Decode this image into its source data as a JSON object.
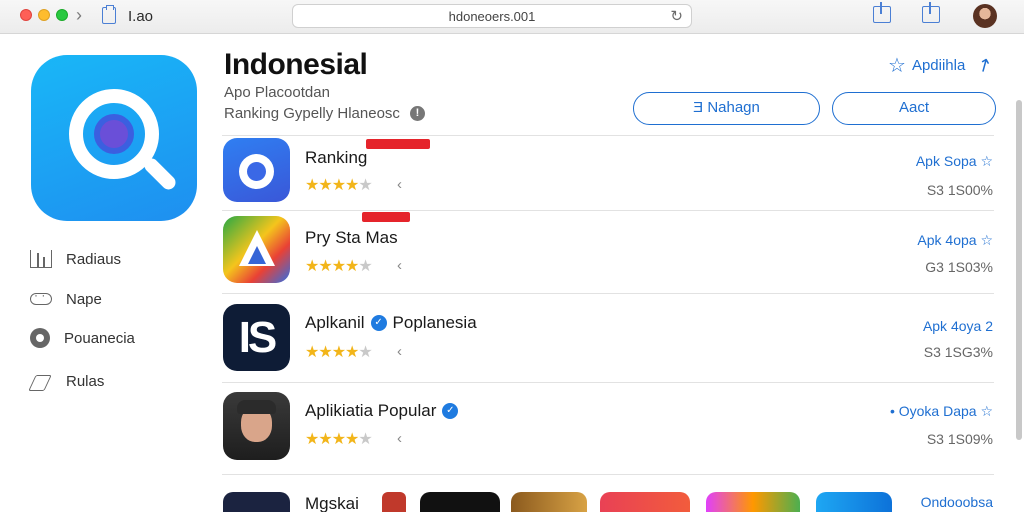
{
  "window": {
    "title": "I.ao",
    "url": "hdoneoers.001"
  },
  "sidebar": {
    "items": [
      {
        "label": "Radiaus",
        "icon": "chart-icon"
      },
      {
        "label": "Nape",
        "icon": "gamepad-icon"
      },
      {
        "label": "Pouanecia",
        "icon": "circle-icon"
      },
      {
        "label": "Rulas",
        "icon": "rules-icon"
      }
    ]
  },
  "header": {
    "title": "Indonesial",
    "subtitle": "Apo Placootdan",
    "meta": "Ranking  Gypelly  Hlaneosc",
    "wishlist_label": "Apdiihla",
    "button_primary": "Ǝ Nahagn",
    "button_secondary": "Aact"
  },
  "apps": [
    {
      "name": "Ranking",
      "verified": false,
      "action": "Apk Sopa ☆",
      "stat": "S3 1S00%",
      "rating": 4.5
    },
    {
      "name": "Pry Sta Mas",
      "verified": false,
      "action": "Apk 4opa ☆",
      "stat": "G3 1S03%",
      "rating": 4.5
    },
    {
      "name": "Aplkanil",
      "name_suffix": "Poplanesia",
      "verified": true,
      "action": "Apk 4oya 2",
      "stat": "S3 1SG3%",
      "rating": 4.5
    },
    {
      "name": "Aplikiatia Popular",
      "verified": true,
      "action": "• Oyoka Dapa ☆",
      "stat": "S3 1S09%",
      "rating": 4.5
    }
  ],
  "bottom_row": {
    "label": "Mgskai",
    "action": "Ondooobsa"
  },
  "colors": {
    "accent": "#1f6fd1",
    "star": "#f2b51a",
    "badge": "#e5242b"
  }
}
